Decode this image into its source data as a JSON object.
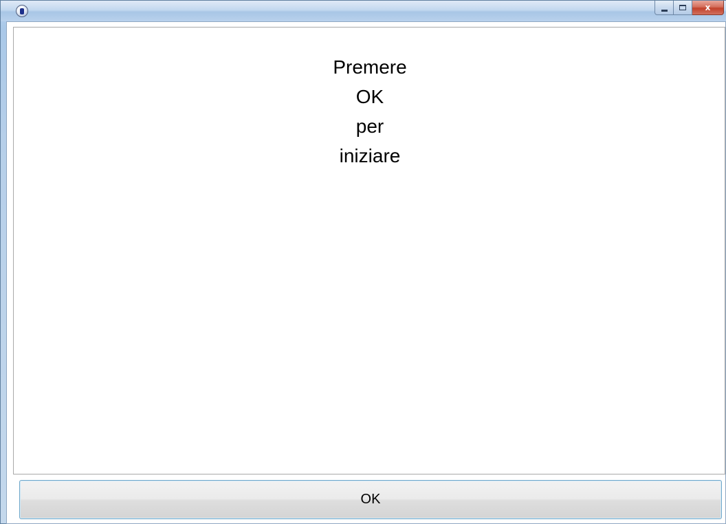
{
  "window": {
    "title": "",
    "app_icon": "info-app-icon",
    "caption": {
      "minimize_icon": "minimize-icon",
      "maximize_icon": "maximize-icon",
      "close_label": "x"
    }
  },
  "message": {
    "lines": [
      "Premere",
      "OK",
      "per",
      "iniziare"
    ]
  },
  "buttons": {
    "ok_label": "OK"
  },
  "colors": {
    "titlebar": "#a8c6e6",
    "close_button": "#c2412b",
    "button_border": "#6fa6c8",
    "background": "#ffffff"
  }
}
